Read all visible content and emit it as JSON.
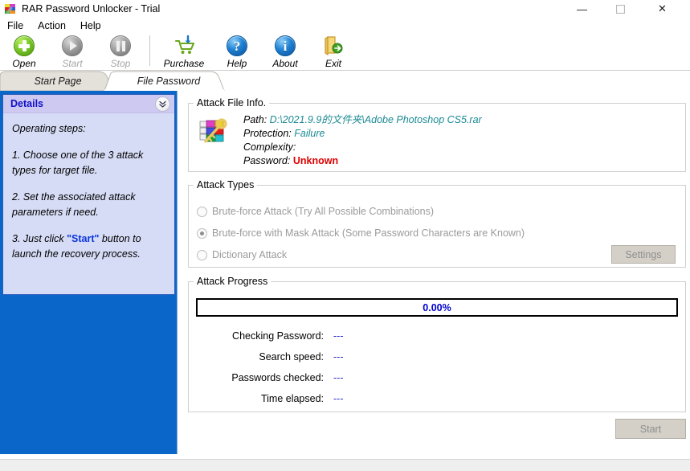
{
  "window": {
    "title": "RAR Password Unlocker - Trial",
    "app_icon": "winrar-key-icon",
    "minimize_label": "—",
    "maximize_label": "□",
    "close_label": "✕"
  },
  "menubar": {
    "items": [
      {
        "label": "File"
      },
      {
        "label": "Action"
      },
      {
        "label": "Help"
      }
    ]
  },
  "toolbar": {
    "buttons": [
      {
        "label": "Open",
        "icon": "open-plus-icon",
        "enabled": true
      },
      {
        "label": "Start",
        "icon": "play-icon",
        "enabled": false
      },
      {
        "label": "Stop",
        "icon": "pause-icon",
        "enabled": false
      },
      {
        "label": "Purchase",
        "icon": "shopping-cart-icon",
        "enabled": true
      },
      {
        "label": "Help",
        "icon": "question-mark-icon",
        "enabled": true
      },
      {
        "label": "About",
        "icon": "info-icon",
        "enabled": true
      },
      {
        "label": "Exit",
        "icon": "exit-door-icon",
        "enabled": true
      }
    ]
  },
  "tabs": {
    "items": [
      {
        "label": "Start Page",
        "active": false
      },
      {
        "label": "File Password",
        "active": true
      }
    ]
  },
  "details_panel": {
    "title": "Details",
    "collapse_icon": "chevron-double-down-icon",
    "intro": "Operating steps:",
    "step1": "1. Choose one of the 3 attack types for target file.",
    "step2": "2. Set the associated attack parameters if need.",
    "step3_a": "3. Just click",
    "step3_kw": "\"Start\"",
    "step3_b": "button to launch the recovery process."
  },
  "file_info": {
    "legend": "Attack File Info.",
    "icon": "rar-archive-key-icon",
    "path_key": "Path:",
    "path_value": "D:\\2021.9.9的文件夹\\Adobe Photoshop CS5.rar",
    "protection_key": "Protection:",
    "protection_value": "Failure",
    "complexity_key": "Complexity:",
    "complexity_value": "",
    "password_key": "Password:",
    "password_value": "Unknown"
  },
  "attack_types": {
    "legend": "Attack Types",
    "options": [
      {
        "label": "Brute-force Attack (Try All Possible Combinations)",
        "selected": false
      },
      {
        "label": "Brute-force with Mask Attack (Some Password Characters are Known)",
        "selected": true
      },
      {
        "label": "Dictionary Attack",
        "selected": false
      }
    ],
    "settings_button": "Settings"
  },
  "attack_progress": {
    "legend": "Attack Progress",
    "percent_label": "0.00%",
    "percent_value": 0,
    "stats": [
      {
        "key": "Checking Password:",
        "value": "---"
      },
      {
        "key": "Search speed:",
        "value": "---"
      },
      {
        "key": "Passwords checked:",
        "value": "---"
      },
      {
        "key": "Time elapsed:",
        "value": "---"
      }
    ]
  },
  "actions": {
    "start_button": "Start"
  },
  "colors": {
    "panel_blue": "#0a66c8",
    "details_bg": "#d6dcf5",
    "details_header": "#cdc9f0",
    "details_title": "#1111cc",
    "teal_value": "#1b8a94",
    "password_red": "#e00000",
    "progress_blue": "#0000d0",
    "stat_value_blue": "#2b2bd0",
    "disabled_grey": "#9b9b9b"
  }
}
